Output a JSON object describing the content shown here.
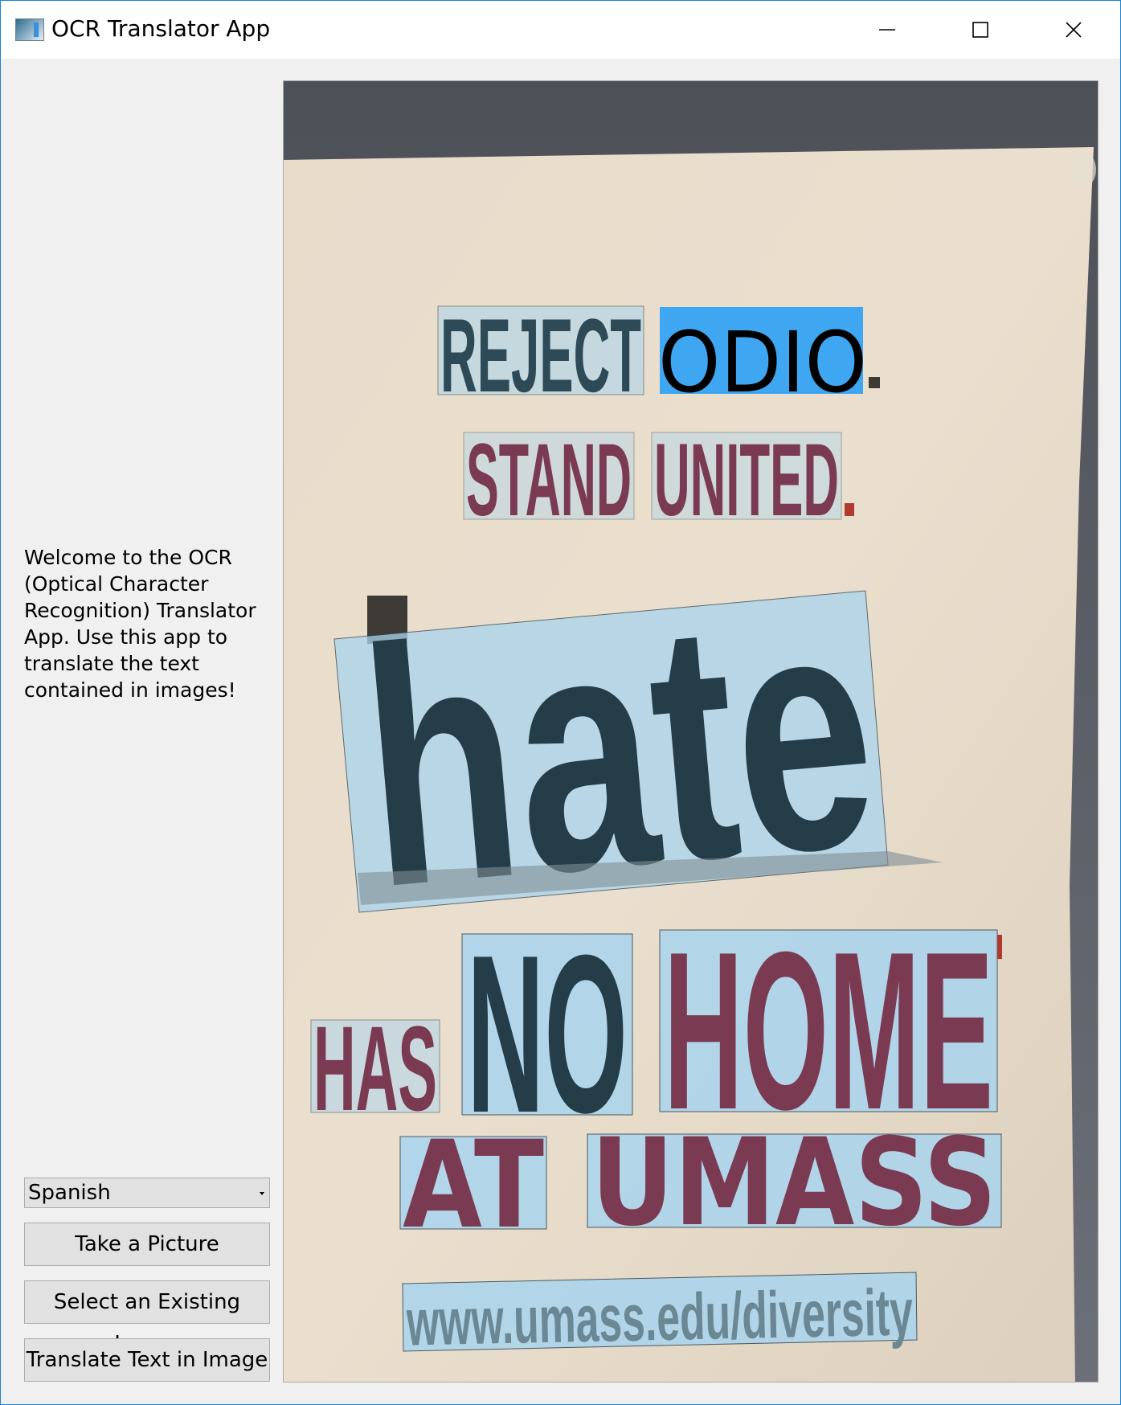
{
  "window": {
    "title": "OCR Translator App",
    "controls": {
      "minimize": "minimize-icon",
      "maximize": "maximize-icon",
      "close": "close-icon"
    }
  },
  "sidebar": {
    "welcome_text": "Welcome to the OCR (Optical Character Recognition) Translator App. Use this app to translate the text contained in images!",
    "language_select": {
      "selected": "Spanish"
    },
    "buttons": {
      "take_picture": "Take a Picture",
      "select_image": "Select an Existing Image",
      "translate": "Translate Text in Image"
    }
  },
  "image": {
    "words": [
      {
        "text": "REJECT",
        "color": "#2e4a56"
      },
      {
        "text": "ODIO",
        "color": "#000000",
        "translated": true,
        "highlight": "#3fa7f2"
      },
      {
        "text": "STAND",
        "color": "#7a3b52"
      },
      {
        "text": "UNITED",
        "color": "#7a3b52"
      },
      {
        "text": "hate",
        "color": "#243d48"
      },
      {
        "text": "HAS",
        "color": "#7a3b52"
      },
      {
        "text": "NO",
        "color": "#243d48"
      },
      {
        "text": "HOME",
        "color": "#7a3b52"
      },
      {
        "text": "AT",
        "color": "#7a3b52"
      },
      {
        "text": "UMASS",
        "color": "#7a3b52"
      },
      {
        "text": "www.umass.edu/diversity",
        "color": "#6b8794"
      }
    ],
    "detection_box_color": "#a9d4ee"
  }
}
